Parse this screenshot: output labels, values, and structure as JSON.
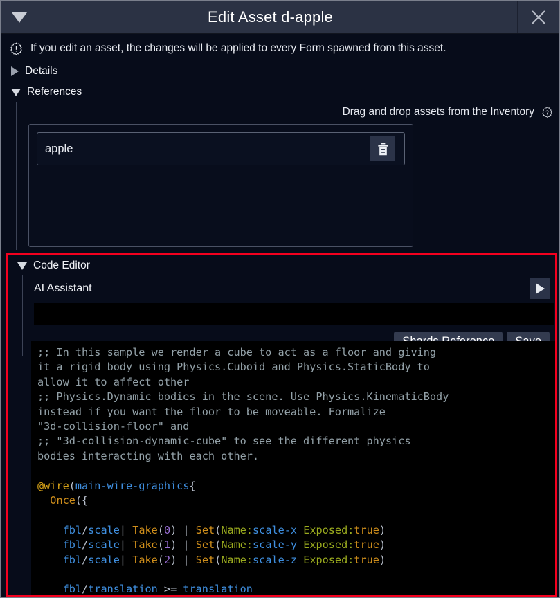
{
  "window": {
    "title": "Edit Asset d-apple",
    "collapse_icon": "triangle-down-icon",
    "close_icon": "close-icon"
  },
  "notice": {
    "icon": "info-badge-icon",
    "text": "If you edit an asset, the changes will be applied to every Form spawned from this asset."
  },
  "sections": {
    "details": {
      "label": "Details",
      "expanded": false,
      "icon": "triangle-right-icon"
    },
    "references": {
      "label": "References",
      "expanded": true,
      "icon": "triangle-down-icon"
    },
    "code_editor": {
      "label": "Code Editor",
      "expanded": true,
      "icon": "triangle-down-icon",
      "highlight_color": "#f3001e"
    }
  },
  "references": {
    "drag_hint": "Drag and drop assets from the Inventory",
    "help_icon": "help-circle-icon",
    "items": [
      {
        "name": "apple",
        "delete_icon": "trash-icon"
      }
    ]
  },
  "code_editor": {
    "ai_assistant_label": "AI Assistant",
    "ai_run_icon": "play-icon",
    "ai_input_value": "",
    "ai_input_placeholder": "",
    "buttons": {
      "shards_reference": "Shards Reference",
      "save": "Save"
    }
  },
  "code": {
    "language": "shards",
    "lines": [
      ";; In this sample we render a cube to act as a floor and giving",
      "it a rigid body using Physics.Cuboid and Physics.StaticBody to",
      "allow it to affect other",
      ";; Physics.Dynamic bodies in the scene. Use Physics.KinematicBody",
      "instead if you want the floor to be moveable. Formalize",
      "\"3d-collision-floor\" and",
      ";; \"3d-collision-dynamic-cube\" to see the different physics",
      "bodies interacting with each other.",
      "",
      "@wire(main-wire-graphics{",
      "  Once({",
      "",
      "    fbl/scale| Take(0) | Set(Name:scale-x Exposed:true)",
      "    fbl/scale| Take(1) | Set(Name:scale-y Exposed:true)",
      "    fbl/scale| Take(2) | Set(Name:scale-z Exposed:true)",
      "",
      "    fbl/translation >= translation"
    ]
  },
  "colors": {
    "titlebar_bg": "#2b3244",
    "body_bg": "#070c1a",
    "code_bg": "#000000",
    "accent_red": "#f3001e",
    "button_bg": "#333b4f",
    "syntax_comment": "#93a1a8",
    "syntax_keyword": "#d4a017",
    "syntax_identifier": "#3f8fe0",
    "syntax_function": "#cf8e1b",
    "syntax_number": "#9a6fd6",
    "syntax_param": "#9aaa1e"
  }
}
